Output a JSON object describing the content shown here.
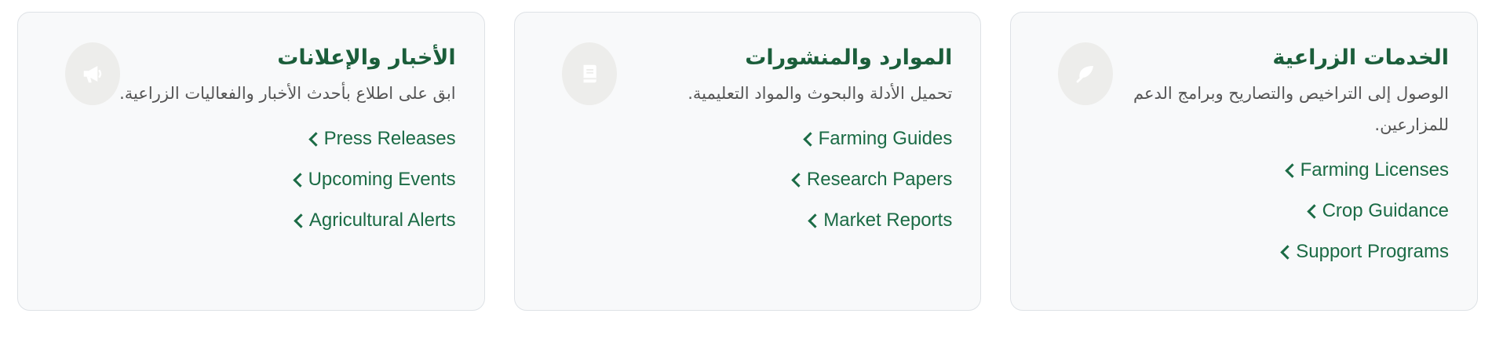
{
  "cards": [
    {
      "title": "الخدمات الزراعية",
      "description": "الوصول إلى التراخيص والتصاريح وبرامج الدعم للمزارعين.",
      "icon": "leaf-icon",
      "links": [
        "Farming Licenses",
        "Crop Guidance",
        "Support Programs"
      ]
    },
    {
      "title": "الموارد والمنشورات",
      "description": "تحميل الأدلة والبحوث والمواد التعليمية.",
      "icon": "book-icon",
      "links": [
        "Farming Guides",
        "Research Papers",
        "Market Reports"
      ]
    },
    {
      "title": "الأخبار والإعلانات",
      "description": "ابق على اطلاع بأحدث الأخبار والفعاليات الزراعية.",
      "icon": "megaphone-icon",
      "links": [
        "Press Releases",
        "Upcoming Events",
        "Agricultural Alerts"
      ]
    }
  ],
  "colors": {
    "title": "#1b5e3b",
    "link": "#1b6b45",
    "card_background": "#f8f9fa",
    "icon_background": "#ededeb",
    "icon_glyph": "#ffffff"
  }
}
